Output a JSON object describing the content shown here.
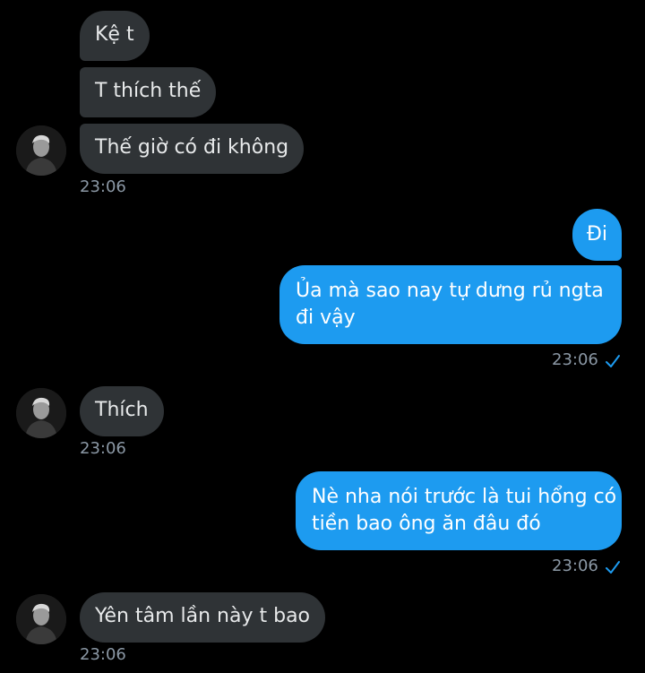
{
  "colors": {
    "background": "#000000",
    "incoming_bubble": "#2f3336",
    "outgoing_bubble": "#1d9bf0",
    "timestamp": "#8b98a5",
    "read_check": "#1d9bf0"
  },
  "messages": {
    "m1": {
      "text": "Kệ t"
    },
    "m2": {
      "text": "T thích thế"
    },
    "m3": {
      "text": "Thế giờ có đi không",
      "time": "23:06"
    },
    "m4": {
      "text": "Đi"
    },
    "m5": {
      "text_line1": "Ủa mà sao nay tự dưng rủ ngta",
      "text_line2": "đi vậy",
      "time": "23:06",
      "status_icon": "check-icon"
    },
    "m6": {
      "text": "Thích",
      "time": "23:06"
    },
    "m7": {
      "text_line1": "Nè nha nói trước là tui hổng có",
      "text_line2": "tiền bao ông ăn đâu đó",
      "time": "23:06",
      "status_icon": "check-icon"
    },
    "m8": {
      "text": "Yên tâm lần này t bao",
      "time": "23:06"
    }
  },
  "avatar_icon": "user-avatar"
}
